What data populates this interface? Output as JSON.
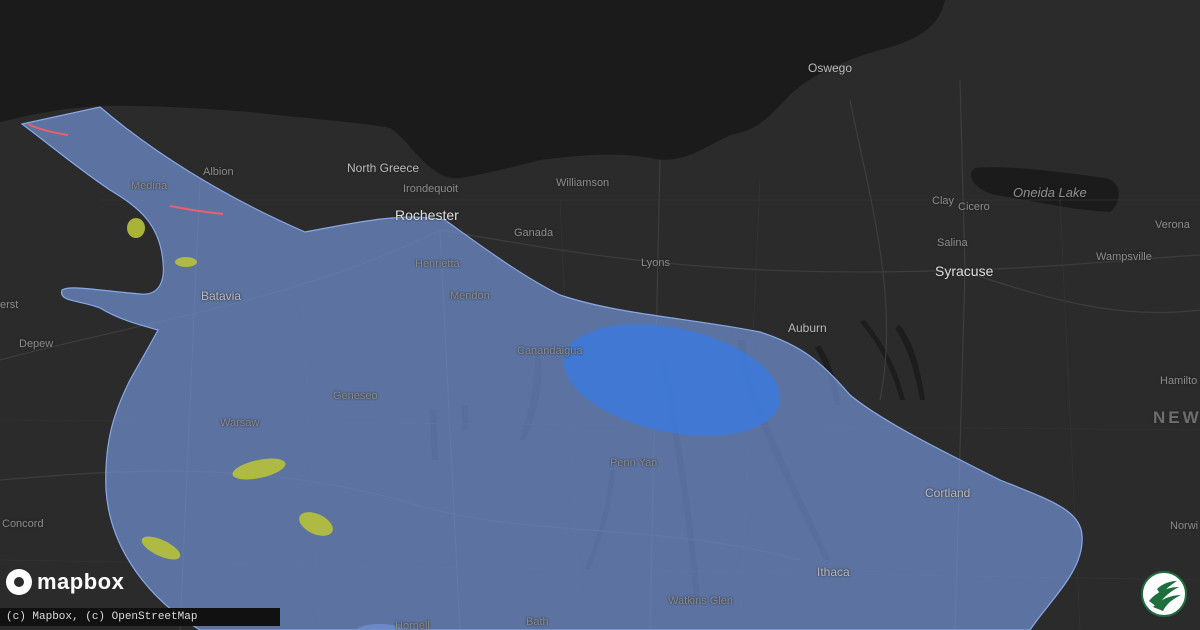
{
  "places": {
    "oswego": "Oswego",
    "north_greece": "North Greece",
    "albion": "Albion",
    "medina": "Medina",
    "irondequoit": "Irondequoit",
    "williamson": "Williamson",
    "rochester": "Rochester",
    "ganada": "Ganada",
    "henrietta": "Henrietta",
    "lyons": "Lyons",
    "batavia": "Batavia",
    "mendon": "Mendon",
    "erst": "erst",
    "depew": "Depew",
    "canandaigua": "Canandaigua",
    "auburn": "Auburn",
    "geneseo": "Geneseo",
    "warsaw": "Warsaw",
    "penn_yan": "Penn Yan",
    "cortland": "Cortland",
    "concord": "Concord",
    "ithaca": "Ithaca",
    "watkins_glen": "Watkins Glen",
    "bath": "Bath",
    "hornell": "Hornell",
    "clay": "Clay",
    "cicero": "Cicero",
    "salina": "Salina",
    "syracuse": "Syracuse",
    "verona": "Verona",
    "wampsville": "Wampsville",
    "hamilton": "Hamilto",
    "norwich": "Norwi",
    "new": "NEW",
    "oneida_lake": "Oneida Lake"
  },
  "logo": {
    "text": "mapbox",
    "icon": "mapbox-logo-icon"
  },
  "attribution": "(c) Mapbox, (c) OpenStreetMap",
  "brand_icon": "weather-brand-icon",
  "colors": {
    "land": "#2b2b2b",
    "lake": "#1b1b1b",
    "swath_fill": "#6f8fd0",
    "core_fill": "#3b79dd",
    "hail_marker": "#b7c23a",
    "wind_line": "#e8606c"
  }
}
